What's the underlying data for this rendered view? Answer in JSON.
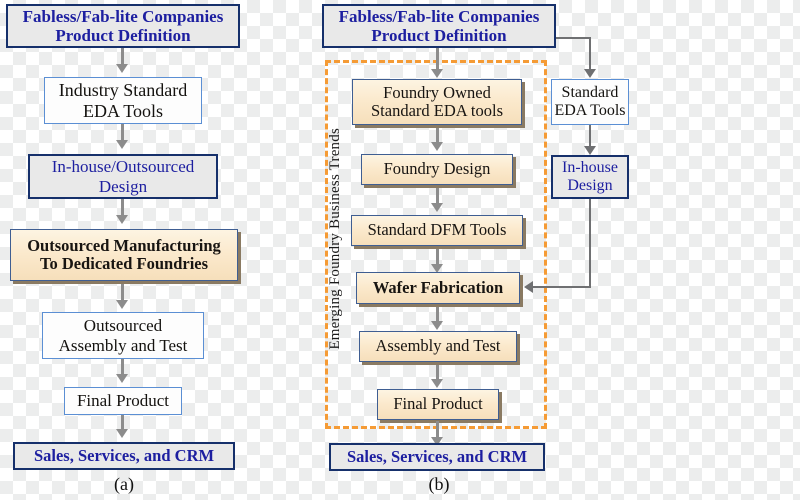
{
  "figure": {
    "panel_a_caption": "(a)",
    "panel_b_caption": "(b)",
    "group_caption_b": "Emerging Foundry Business Trends"
  },
  "colors": {
    "navy_text": "#1d1fa0",
    "navy_border": "#16306b",
    "plain_border": "#5b8fd4",
    "tan_fill": "#fbe9cc",
    "dashed_orange": "#f59b35",
    "arrow_gray": "#8c8c8c",
    "connector_gray": "#6f7072"
  },
  "panel_a": {
    "nodes": [
      {
        "id": "a-header",
        "label": "Fabless/Fab-lite Companies\nProduct  Definition",
        "style": "header"
      },
      {
        "id": "a-eda",
        "label": "Industry Standard\nEDA Tools",
        "style": "plain"
      },
      {
        "id": "a-design",
        "label": "In-house/Outsourced\nDesign",
        "style": "navy"
      },
      {
        "id": "a-outsourced",
        "label": "Outsourced Manufacturing\nTo Dedicated Foundries",
        "style": "tan-bold"
      },
      {
        "id": "a-assembly",
        "label": "Outsourced\nAssembly and Test",
        "style": "plain"
      },
      {
        "id": "a-final",
        "label": "Final Product",
        "style": "plain"
      },
      {
        "id": "a-sales",
        "label": "Sales, Services, and CRM",
        "style": "header"
      }
    ]
  },
  "panel_b": {
    "nodes": [
      {
        "id": "b-header",
        "label": "Fabless/Fab-lite Companies\nProduct  Definition",
        "style": "header"
      },
      {
        "id": "b-foundry-eda",
        "label": "Foundry Owned\nStandard EDA tools",
        "style": "tan"
      },
      {
        "id": "b-foundry-design",
        "label": "Foundry Design",
        "style": "tan"
      },
      {
        "id": "b-dfm",
        "label": "Standard DFM Tools",
        "style": "tan"
      },
      {
        "id": "b-wafer",
        "label": "Wafer Fabrication",
        "style": "tan-bold"
      },
      {
        "id": "b-assembly",
        "label": "Assembly and Test",
        "style": "tan"
      },
      {
        "id": "b-final",
        "label": "Final Product",
        "style": "tan"
      },
      {
        "id": "b-sales",
        "label": "Sales, Services, and CRM",
        "style": "header"
      },
      {
        "id": "b-std-eda",
        "label": "Standard\nEDA Tools",
        "style": "plain"
      },
      {
        "id": "b-inhouse",
        "label": "In-house\nDesign",
        "style": "navy"
      }
    ]
  }
}
